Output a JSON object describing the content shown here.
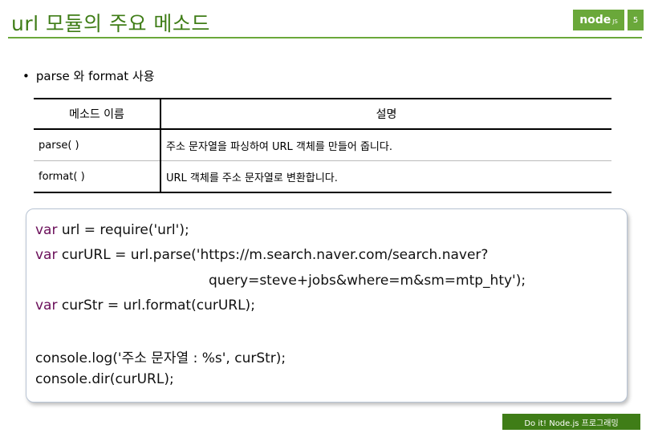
{
  "header": {
    "title": "url 모듈의 주요 메소드",
    "logo_text": "node",
    "logo_sub": "JS",
    "page_number": "5"
  },
  "bullet": {
    "symbol": "•",
    "text": "parse 와 format 사용"
  },
  "table": {
    "headers": [
      "메소드 이름",
      "설명"
    ],
    "rows": [
      {
        "name": "parse( )",
        "desc": "주소 문자열을 파싱하여 URL 객체를 만들어 줍니다."
      },
      {
        "name": "format( )",
        "desc": "URL 객체를 주소 문자열로 변환합니다."
      }
    ]
  },
  "code": {
    "line1_kw": "var",
    "line1_rest": " url = require('url');",
    "line2_kw": "var",
    "line2_rest": " curURL = url.parse('https://m.search.naver.com/search.naver?",
    "line3": "query=steve+jobs&where=m&sm=mtp_hty');",
    "line4_kw": "var",
    "line4_rest": " curStr = url.format(curURL);",
    "line5": "console.log('주소 문자열 : %s', curStr);",
    "line6": "console.dir(curURL);"
  },
  "footer": {
    "text": "Do it! Node.js 프로그래밍"
  },
  "colors": {
    "accent_green": "#6aa83a",
    "dark_green": "#3f7d17",
    "keyword": "#6b0f5a"
  }
}
